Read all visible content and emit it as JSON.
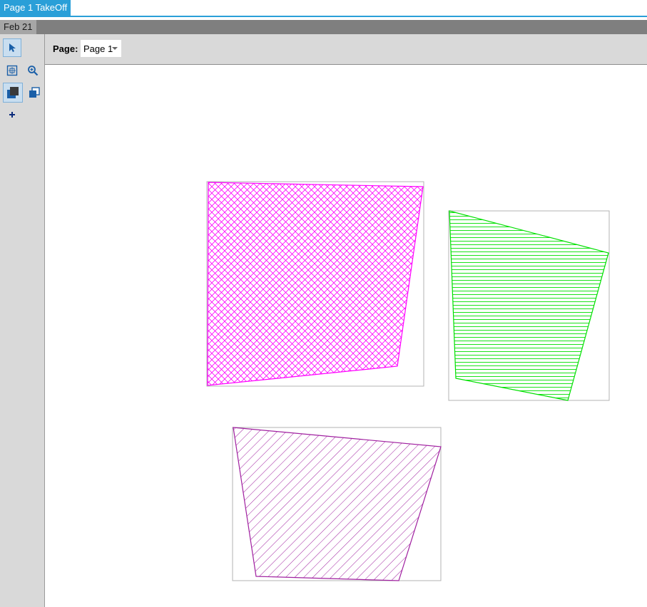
{
  "window": {
    "tab_title": "Page 1 TakeOff"
  },
  "document": {
    "tab_label": "Feb 21"
  },
  "page_selector": {
    "label": "Page:",
    "selected": "Page 1"
  },
  "tools": [
    {
      "name": "select-pointer-icon",
      "active": true
    },
    {
      "name": "fit-page-icon",
      "active": false
    },
    {
      "name": "zoom-in-icon",
      "active": false
    },
    {
      "name": "layer-front-icon",
      "active": true
    },
    {
      "name": "layer-back-icon",
      "active": false
    },
    {
      "name": "add-icon",
      "active": false
    }
  ],
  "colors": {
    "accent": "#2a9fd8",
    "area_magenta": "#ff00ff",
    "area_green": "#00e000",
    "area_purple": "#a020a0"
  },
  "takeoff_areas": [
    {
      "name": "takeoff-area-magenta",
      "fill": "crosshatch",
      "color": "#ff00ff"
    },
    {
      "name": "takeoff-area-green",
      "fill": "horizontal",
      "color": "#00e000"
    },
    {
      "name": "takeoff-area-purple",
      "fill": "diagonal",
      "color": "#a020a0"
    }
  ]
}
